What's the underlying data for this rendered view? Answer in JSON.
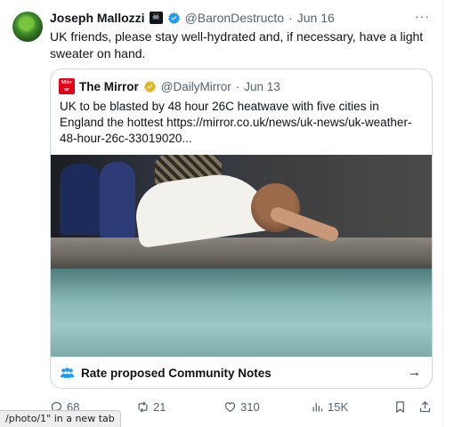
{
  "tweet": {
    "author_name": "Joseph Mallozzi",
    "handle": "@BaronDestructo",
    "date": "Jun 16",
    "text": "UK friends, please stay well-hydrated and, if necessary, have a light sweater on hand."
  },
  "quoted": {
    "logo_text": "Mirror",
    "author_name": "The Mirror",
    "handle": "@DailyMirror",
    "date": "Jun 13",
    "text": "UK to be blasted by 48 hour 26C heatwave with five cities in England the hottest https://mirror.co.uk/news/uk-news/uk-weather-48-hour-26c-33019020...",
    "community_notes_label": "Rate proposed Community Notes"
  },
  "actions": {
    "replies": "68",
    "reposts": "21",
    "likes": "310",
    "views": "15K"
  },
  "status_bar": {
    "text": "/photo/1\" in a new tab"
  },
  "colors": {
    "verified_blue": "#1d9bf0",
    "verified_gold": "#e6b422",
    "mirror_red": "#e2001a",
    "muted_text": "#536471"
  },
  "icons": [
    "pirate-flag-icon",
    "verified-badge-icon",
    "more-icon",
    "people-icon",
    "arrow-right-icon",
    "reply-icon",
    "repost-icon",
    "like-icon",
    "views-icon",
    "bookmark-icon",
    "share-icon"
  ]
}
